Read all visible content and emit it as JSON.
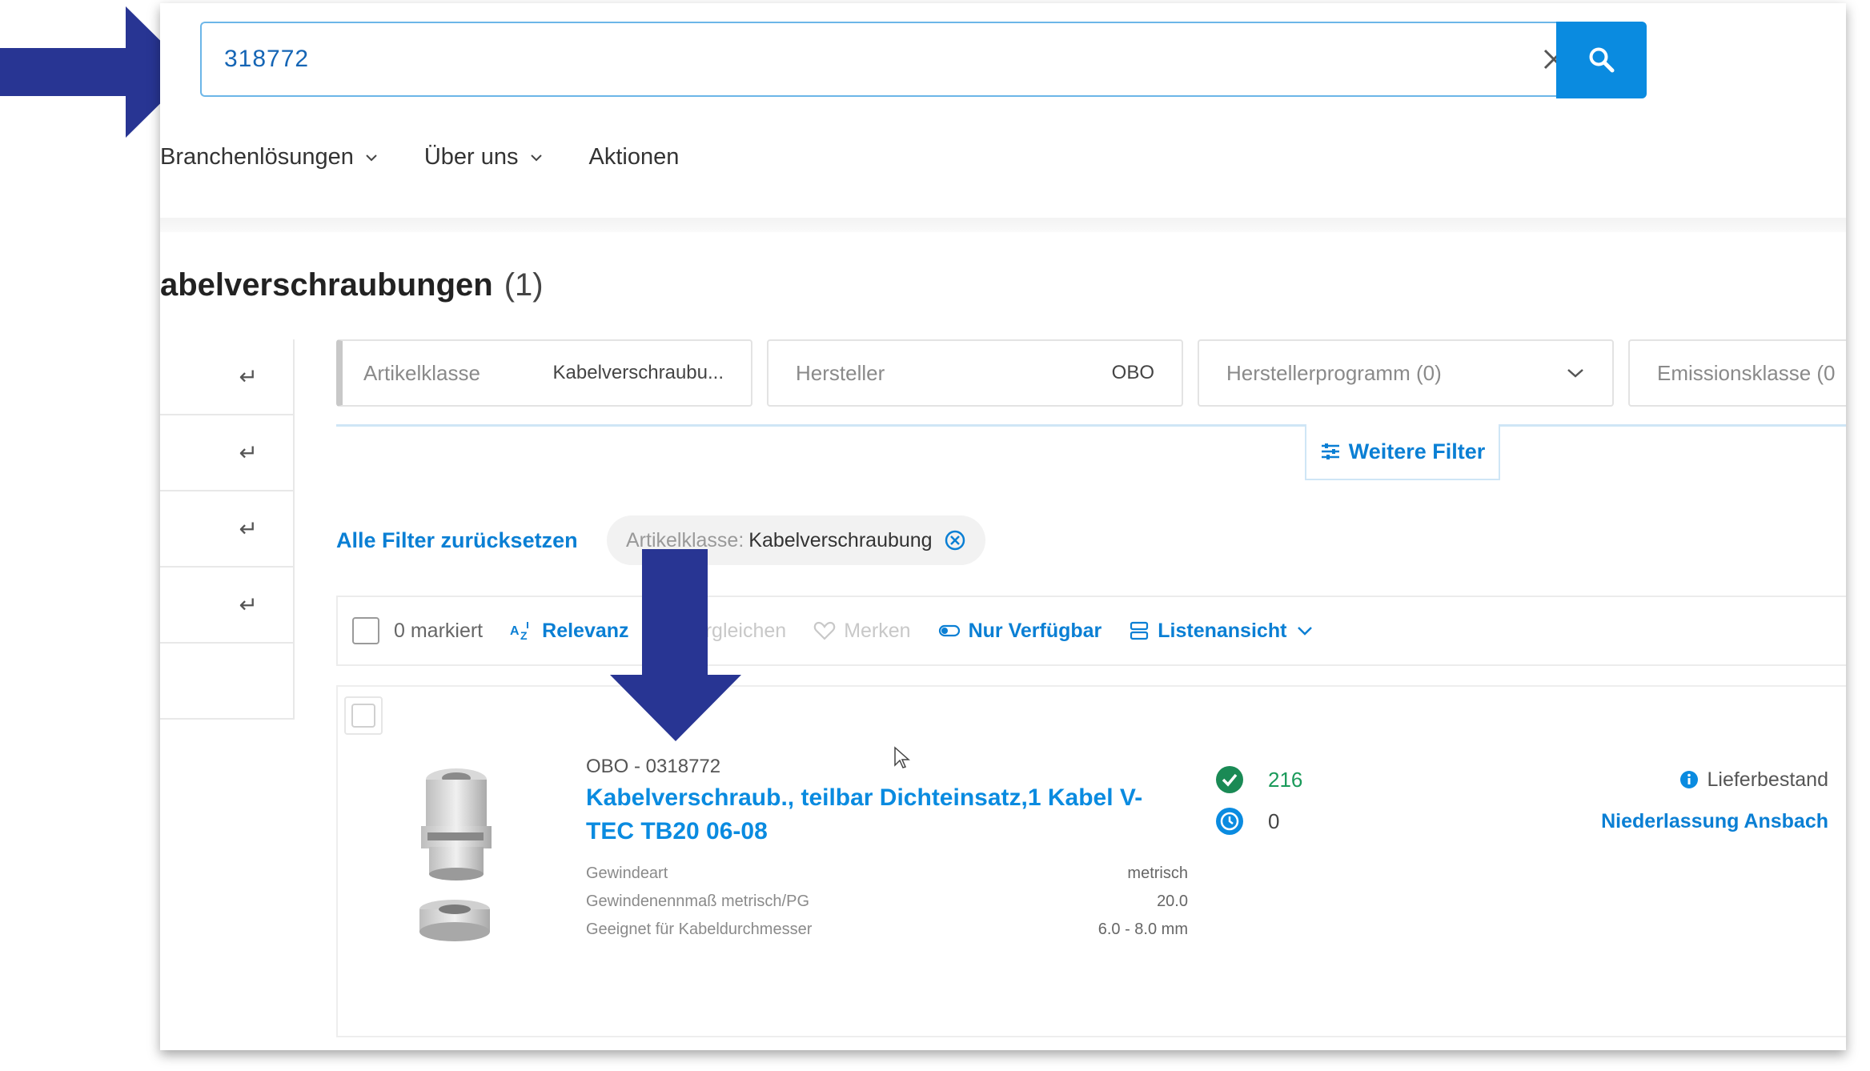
{
  "search": {
    "value": "318772"
  },
  "nav": {
    "items": [
      {
        "label": "Branchenlösungen",
        "has_dropdown": true
      },
      {
        "label": "Über uns",
        "has_dropdown": true
      },
      {
        "label": "Aktionen",
        "has_dropdown": false
      }
    ]
  },
  "page": {
    "title": "abelverschraubungen",
    "count": "(1)"
  },
  "filters": {
    "artikelklasse": {
      "label": "Artikelklasse",
      "value": "Kabelverschraubu..."
    },
    "hersteller": {
      "label": "Hersteller",
      "value": "OBO"
    },
    "herstellerprogramm": {
      "label": "Herstellerprogramm (0)"
    },
    "emissionsklasse": {
      "label": "Emissionsklasse (0"
    },
    "weitere": "Weitere Filter",
    "reset": "Alle Filter zurücksetzen",
    "active_chip": {
      "label": "Artikelklasse:",
      "value": "Kabelverschraubung"
    }
  },
  "toolbar": {
    "marked": "0 markiert",
    "sort": "Relevanz",
    "compare": "Vergleichen",
    "remember": "Merken",
    "available_only": "Nur Verfügbar",
    "view": "Listenansicht"
  },
  "product": {
    "meta": "OBO - 0318772",
    "title": "Kabelverschraub., teilbar Dichteinsatz,1 Kabel V-TEC TB20 06-08",
    "specs": [
      {
        "label": "Gewindeart",
        "value": "metrisch"
      },
      {
        "label": "Gewindenennmaß metrisch/PG",
        "value": "20.0"
      },
      {
        "label": "Geeignet für Kabeldurchmesser",
        "value": "6.0 - 8.0 mm"
      }
    ],
    "stock_available": "216",
    "stock_incoming": "0",
    "delivery_label": "Lieferbestand",
    "branch": "Niederlassung Ansbach"
  },
  "colors": {
    "accent": "#0a8be0",
    "annotation_arrow": "#283593",
    "in_stock": "#1a9a5a"
  },
  "icons": [
    "close-icon",
    "search-icon",
    "chevron-down-icon",
    "enter-icon",
    "filter-sliders-icon",
    "circle-x-icon",
    "sort-az-icon",
    "compare-icon",
    "heart-icon",
    "toggle-icon",
    "list-view-icon",
    "check-circle-icon",
    "clock-icon",
    "info-icon",
    "mouse-cursor-icon"
  ]
}
